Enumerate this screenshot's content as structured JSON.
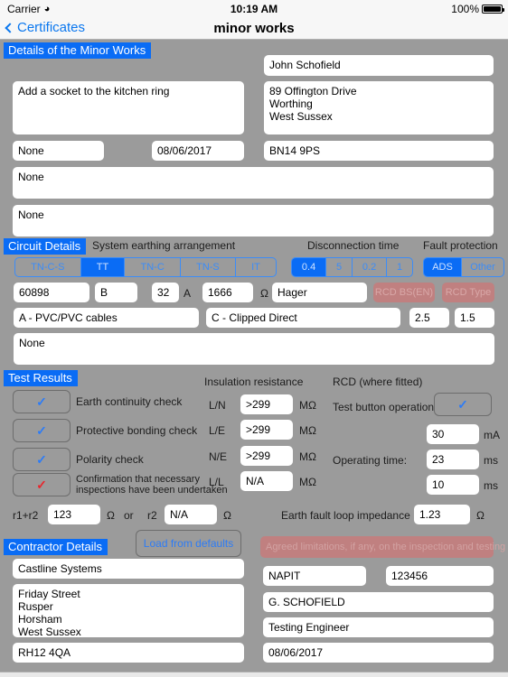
{
  "status_bar": {
    "carrier": "Carrier",
    "wifi_icon": "wifi-icon",
    "time": "10:19 AM",
    "battery_percent": "100%"
  },
  "nav": {
    "back_label": "Certificates",
    "title": "minor works"
  },
  "details_section": {
    "header": "Details of the Minor Works",
    "client_name": "John Schofield",
    "description_of_works": "Add a socket to the kitchen ring",
    "address": "89 Offington Drive\nWorthing\nWest Sussex",
    "departures": "None",
    "date": "08/06/2017",
    "postcode": "BN14 9PS",
    "comments_1": "None",
    "comments_2": "None"
  },
  "circuit_section": {
    "header": "Circuit Details",
    "earthing_label": "System earthing arrangement",
    "disconnection_label": "Disconnection time",
    "fault_protection_label": "Fault protection",
    "earthing_options": [
      "TN-C-S",
      "TT",
      "TN-C",
      "TN-S",
      "IT"
    ],
    "earthing_selected": "TT",
    "disconnection_options": [
      "0.4",
      "5",
      "0.2",
      "1"
    ],
    "disconnection_selected": "0.4",
    "fault_options": [
      "ADS",
      "Other"
    ],
    "fault_selected": "ADS",
    "bs_number": "60898",
    "type": "B",
    "rating": "32",
    "rating_unit": "A",
    "breaking_capacity": "1666",
    "capacity_unit": "Ω",
    "manufacturer": "Hager",
    "rcd_bs_en_button": "RCD BS(EN)",
    "rcd_type_button": "RCD Type",
    "wiring_type": "A - PVC/PVC cables",
    "installation_method": "C - Clipped Direct",
    "live_csa": "2.5",
    "cpc_csa": "1.5",
    "circuit_notes": "None"
  },
  "test_section": {
    "header": "Test Results",
    "insulation_label": "Insulation resistance",
    "rcd_label": "RCD (where fitted)",
    "checks": [
      {
        "label": "Earth continuity check",
        "ticked": true,
        "tick_color": "blue"
      },
      {
        "label": "Protective bonding check",
        "ticked": true,
        "tick_color": "blue"
      },
      {
        "label": "Polarity check",
        "ticked": true,
        "tick_color": "blue"
      },
      {
        "label": "Confirmation that necessary\ninspections have been undertaken",
        "ticked": true,
        "tick_color": "red"
      }
    ],
    "insulation_rows": [
      {
        "label": "L/N",
        "value": ">299",
        "unit": "MΩ"
      },
      {
        "label": "L/E",
        "value": ">299",
        "unit": "MΩ"
      },
      {
        "label": "N/E",
        "value": ">299",
        "unit": "MΩ"
      },
      {
        "label": "L/L",
        "value": "N/A",
        "unit": "MΩ"
      }
    ],
    "test_button_label": "Test button operation",
    "test_button_ticked": true,
    "rcd_rating": "30",
    "rcd_rating_unit": "mA",
    "operating_time_label": "Operating time:",
    "operating_time_1": "23",
    "operating_time_1_unit": "ms",
    "operating_time_2": "10",
    "operating_time_2_unit": "ms",
    "r1r2_label": "r1+r2",
    "r1r2_value": "123",
    "r1r2_unit": "Ω",
    "or_label": "or",
    "r2_label": "r2",
    "r2_value": "N/A",
    "r2_unit": "Ω",
    "zs_label": "Earth fault loop impedance",
    "zs_value": "1.23",
    "zs_unit": "Ω"
  },
  "contractor_section": {
    "header": "Contractor Details",
    "load_defaults_button": "Load from defaults",
    "agreed_limitations_banner": "Agreed limitations, if any, on the inspection and testing",
    "company_name": "Castline Systems",
    "company_address": "Friday Street\nRusper\nHorsham\nWest Sussex",
    "company_postcode": "RH12 4QA",
    "scheme": "NAPIT",
    "membership_number": "123456",
    "signatory": "G. SCHOFIELD",
    "position": "Testing Engineer",
    "sign_date": "08/06/2017"
  },
  "colors": {
    "accent_blue": "#0a6cf5",
    "link_blue": "#2d7cf6",
    "page_bg": "#9b9b9b",
    "field_bg": "#ffffff",
    "disabled_red": "#c08080",
    "tick_red": "#e8262d"
  }
}
